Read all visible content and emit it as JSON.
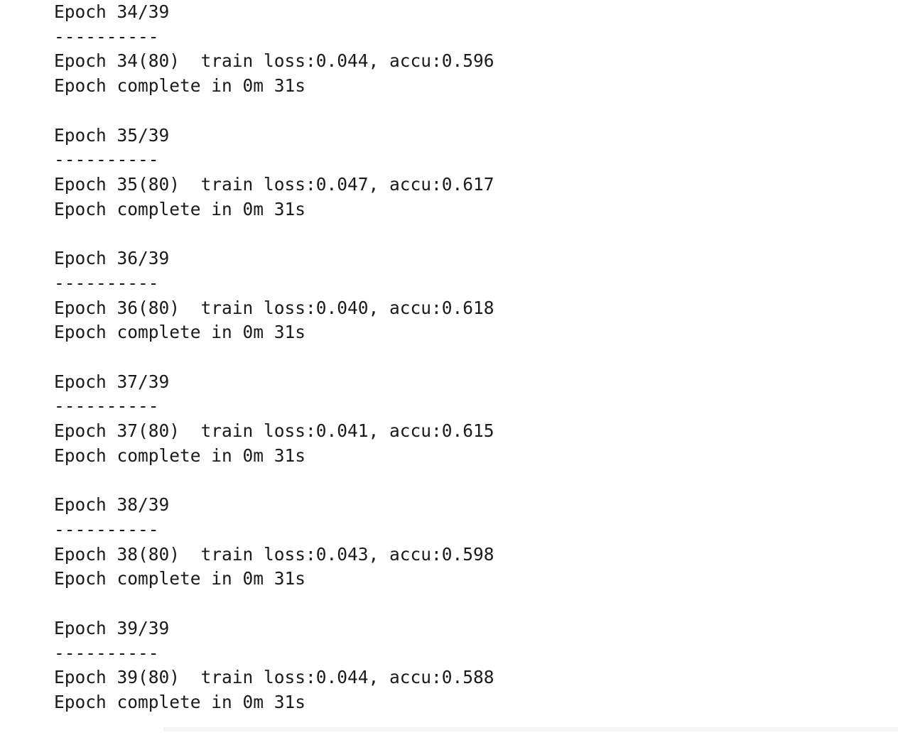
{
  "output": {
    "blocks": [
      {
        "header": "Epoch 34/39",
        "separator": "----------",
        "stats": "Epoch 34(80)  train loss:0.044, accu:0.596",
        "complete": "Epoch complete in 0m 31s"
      },
      {
        "header": "Epoch 35/39",
        "separator": "----------",
        "stats": "Epoch 35(80)  train loss:0.047, accu:0.617",
        "complete": "Epoch complete in 0m 31s"
      },
      {
        "header": "Epoch 36/39",
        "separator": "----------",
        "stats": "Epoch 36(80)  train loss:0.040, accu:0.618",
        "complete": "Epoch complete in 0m 31s"
      },
      {
        "header": "Epoch 37/39",
        "separator": "----------",
        "stats": "Epoch 37(80)  train loss:0.041, accu:0.615",
        "complete": "Epoch complete in 0m 31s"
      },
      {
        "header": "Epoch 38/39",
        "separator": "----------",
        "stats": "Epoch 38(80)  train loss:0.043, accu:0.598",
        "complete": "Epoch complete in 0m 31s"
      },
      {
        "header": "Epoch 39/39",
        "separator": "----------",
        "stats": "Epoch 39(80)  train loss:0.044, accu:0.588",
        "complete": "Epoch complete in 0m 31s"
      }
    ]
  },
  "colors": {
    "text": "#1a1a1a",
    "background": "#ffffff"
  }
}
